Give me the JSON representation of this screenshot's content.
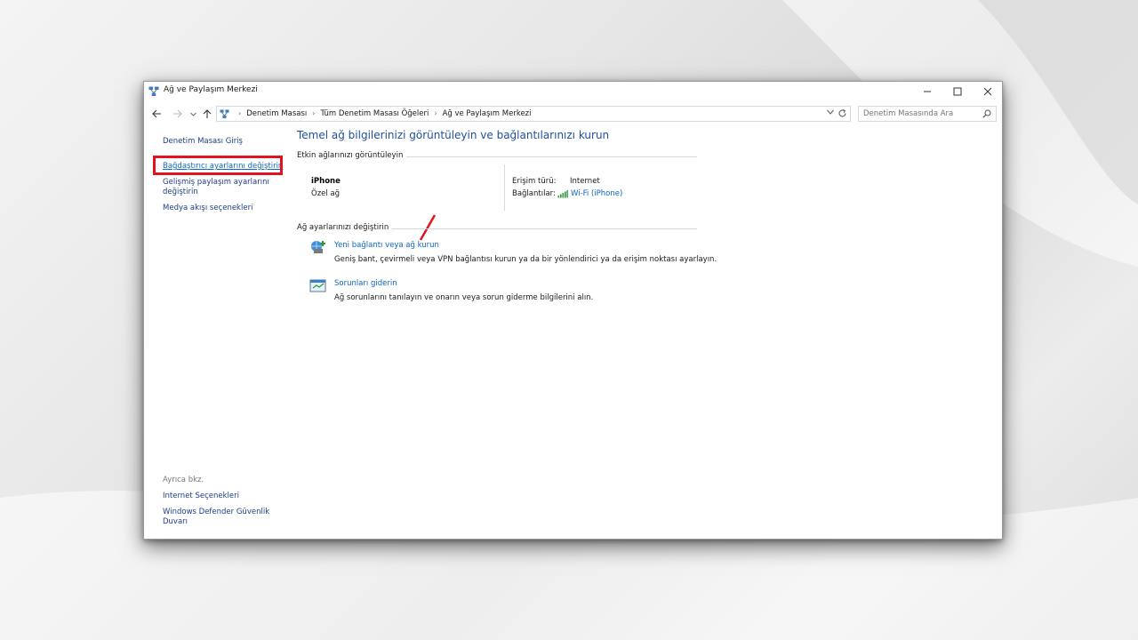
{
  "window": {
    "title": "Ağ ve Paylaşım Merkezi"
  },
  "nav": {
    "breadcrumbs": [
      "Denetim Masası",
      "Tüm Denetim Masası Öğeleri",
      "Ağ ve Paylaşım Merkezi"
    ],
    "search_placeholder": "Denetim Masasında Ara"
  },
  "sidebar": {
    "home": "Denetim Masası Giriş",
    "adapter_settings": "Bağdaştırıcı ayarlarını değiştirin",
    "advanced_sharing": "Gelişmiş paylaşım ayarlarını değiştirin",
    "media_streaming": "Medya akışı seçenekleri",
    "see_also": "Ayrıca bkz.",
    "internet_options": "Internet Seçenekleri",
    "firewall": "Windows Defender Güvenlik Duvarı"
  },
  "main": {
    "title": "Temel ağ bilgilerinizi görüntüleyin ve bağlantılarınızı kurun",
    "active_networks_label": "Etkin ağlarınızı görüntüleyin",
    "network": {
      "name": "iPhone",
      "type": "Özel ağ",
      "access_type_label": "Erişim türü:",
      "access_type_value": "Internet",
      "connections_label": "Bağlantılar:",
      "connection_value": "Wi-Fi (iPhone)"
    },
    "change_settings_label": "Ağ ayarlarınızı değiştirin",
    "tasks": [
      {
        "link": "Yeni bağlantı veya ağ kurun",
        "description": "Geniş bant, çevirmeli veya VPN bağlantısı kurun ya da bir yönlendirici ya da erişim noktası ayarlayın."
      },
      {
        "link": "Sorunları giderin",
        "description": "Ağ sorunlarını tanılayın ve onarın veya sorun giderme bilgilerini alın."
      }
    ]
  },
  "colors": {
    "link": "#0b66c9",
    "title_blue": "#1e4f9c",
    "highlight": "#e0141e"
  }
}
